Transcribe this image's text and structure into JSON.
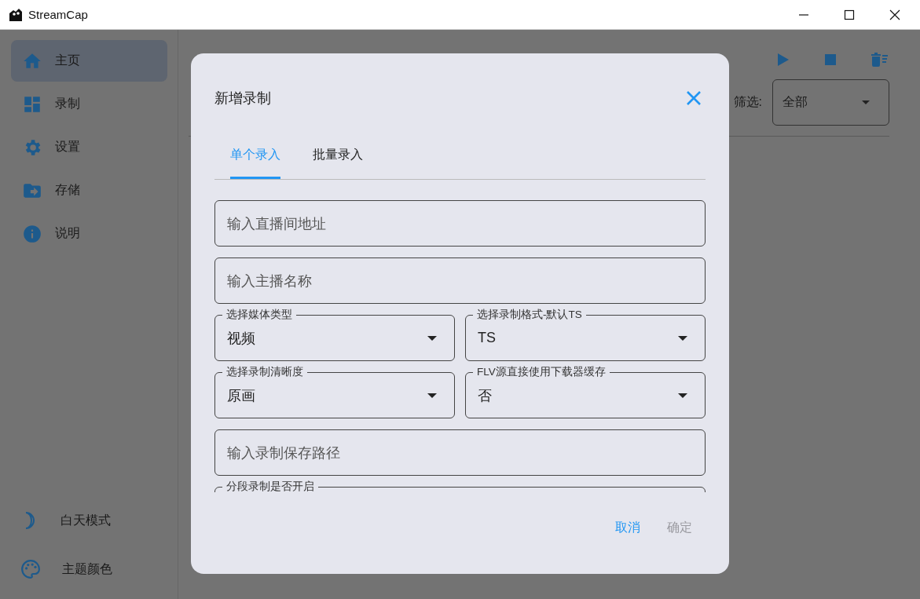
{
  "window": {
    "title": "StreamCap"
  },
  "sidebar": {
    "items": [
      {
        "label": "主页",
        "selected": true
      },
      {
        "label": "录制",
        "selected": false
      },
      {
        "label": "设置",
        "selected": false
      },
      {
        "label": "存储",
        "selected": false
      },
      {
        "label": "说明",
        "selected": false
      }
    ],
    "footer": [
      {
        "label": "白天模式"
      },
      {
        "label": "主题颜色"
      }
    ]
  },
  "filter": {
    "label": "筛选:",
    "value": "全部"
  },
  "dialog": {
    "title": "新增录制",
    "tabs": [
      {
        "label": "单个录入",
        "selected": true
      },
      {
        "label": "批量录入",
        "selected": false
      }
    ],
    "rows": [
      [
        {
          "kind": "input",
          "placeholder": "输入直播间地址"
        }
      ],
      [
        {
          "kind": "input",
          "placeholder": "输入主播名称"
        }
      ],
      [
        {
          "kind": "select",
          "label": "选择媒体类型",
          "value": "视频"
        },
        {
          "kind": "select",
          "label": "选择录制格式-默认TS",
          "value": "TS"
        }
      ],
      [
        {
          "kind": "select",
          "label": "选择录制清晰度",
          "value": "原画"
        },
        {
          "kind": "select",
          "label": "FLV源直接使用下载器缓存",
          "value": "否"
        }
      ],
      [
        {
          "kind": "input",
          "placeholder": "输入录制保存路径"
        }
      ],
      [
        {
          "kind": "select",
          "label": "分段录制是否开启"
        }
      ]
    ],
    "buttons": [
      {
        "label": "取消",
        "disabled": false
      },
      {
        "label": "确定",
        "disabled": true
      }
    ]
  }
}
